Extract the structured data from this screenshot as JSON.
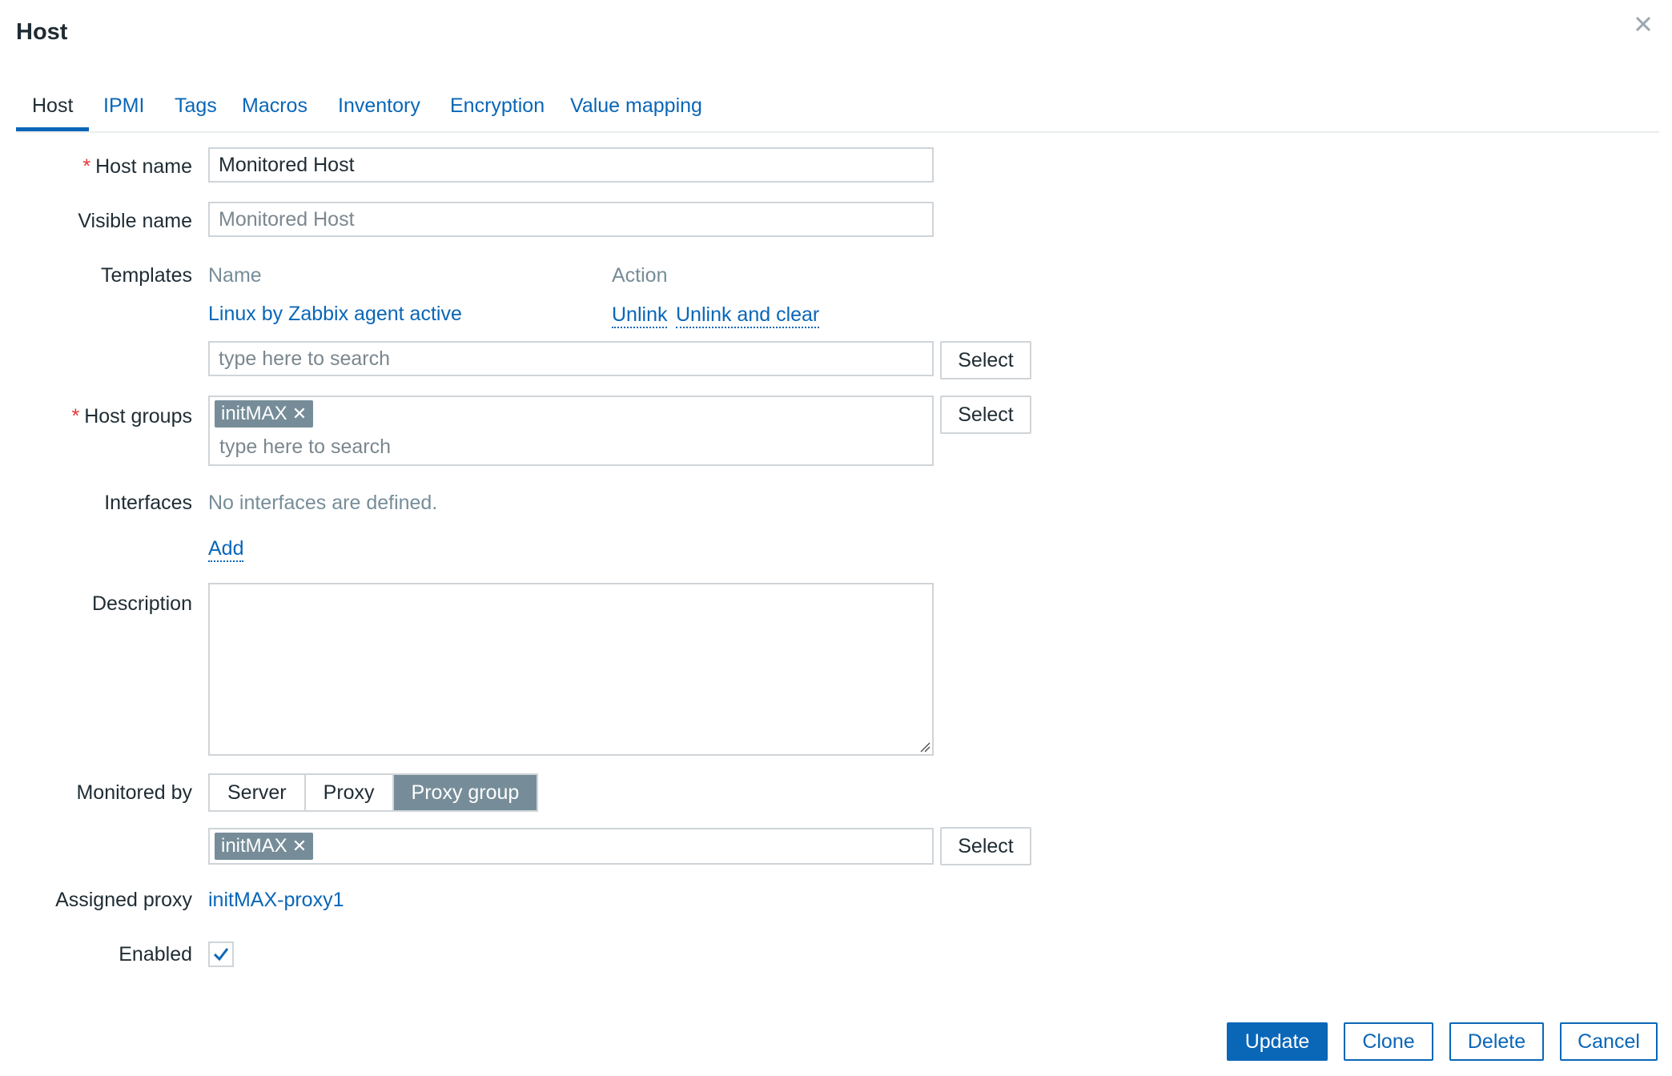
{
  "dialog": {
    "title": "Host"
  },
  "tabs": [
    {
      "label": "Host",
      "active": true
    },
    {
      "label": "IPMI"
    },
    {
      "label": "Tags"
    },
    {
      "label": "Macros"
    },
    {
      "label": "Inventory"
    },
    {
      "label": "Encryption"
    },
    {
      "label": "Value mapping"
    }
  ],
  "form": {
    "host_name": {
      "label": "Host name",
      "value": "Monitored Host"
    },
    "visible_name": {
      "label": "Visible name",
      "placeholder": "Monitored Host",
      "value": ""
    },
    "templates": {
      "label": "Templates",
      "col_name": "Name",
      "col_action": "Action",
      "linked": [
        {
          "name": "Linux by Zabbix agent active",
          "unlink": "Unlink",
          "unlink_clear": "Unlink and clear"
        }
      ],
      "search_placeholder": "type here to search",
      "select_label": "Select"
    },
    "host_groups": {
      "label": "Host groups",
      "chips": [
        "initMAX"
      ],
      "search_placeholder": "type here to search",
      "select_label": "Select"
    },
    "interfaces": {
      "label": "Interfaces",
      "empty_text": "No interfaces are defined.",
      "add_label": "Add"
    },
    "description": {
      "label": "Description",
      "value": ""
    },
    "monitored_by": {
      "label": "Monitored by",
      "options": [
        "Server",
        "Proxy",
        "Proxy group"
      ],
      "selected": "Proxy group",
      "chips": [
        "initMAX"
      ],
      "select_label": "Select"
    },
    "assigned_proxy": {
      "label": "Assigned proxy",
      "value": "initMAX-proxy1"
    },
    "enabled": {
      "label": "Enabled",
      "checked": true
    }
  },
  "footer": {
    "update": "Update",
    "clone": "Clone",
    "delete": "Delete",
    "cancel": "Cancel"
  },
  "colors": {
    "accent": "#0a66b7",
    "chip": "#768d99",
    "required": "#e33734"
  }
}
